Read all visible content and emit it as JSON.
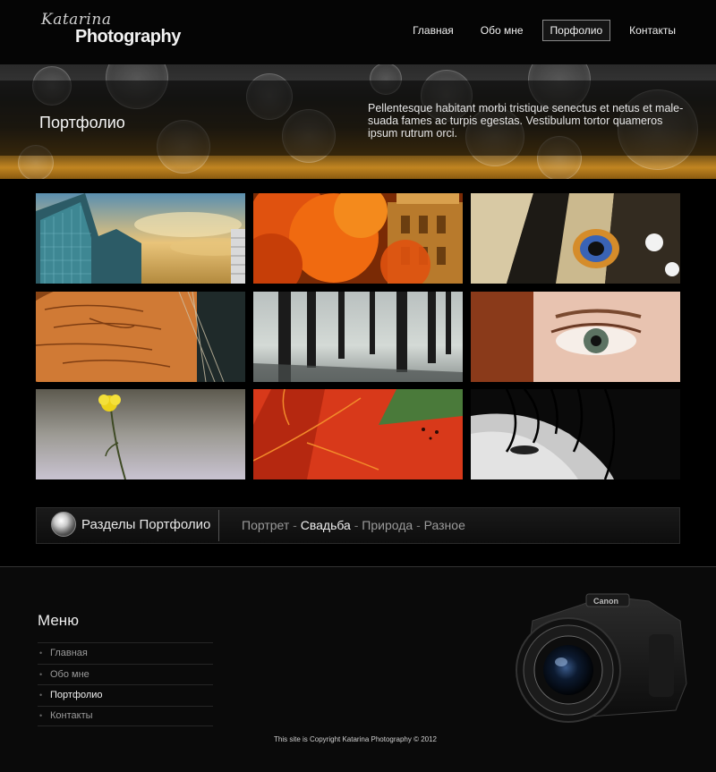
{
  "header": {
    "logo_script": "Katarina",
    "logo_main": "Photography",
    "nav": [
      {
        "label": "Главная",
        "active": false
      },
      {
        "label": "Обо мне",
        "active": false
      },
      {
        "label": "Порфолио",
        "active": true
      },
      {
        "label": "Контакты",
        "active": false
      }
    ]
  },
  "banner": {
    "title": "Портфолио",
    "text": "Pellentesque habitant morbi tristique senectus et netus et male-suada fames ac turpis egestas. Vestibulum tortor quameros ipsum rutrum orci."
  },
  "gallery": {
    "items": [
      {
        "subject": "building"
      },
      {
        "subject": "autumn-tree"
      },
      {
        "subject": "butterfly-wing"
      },
      {
        "subject": "old-face"
      },
      {
        "subject": "forest"
      },
      {
        "subject": "eye"
      },
      {
        "subject": "yellow-flower"
      },
      {
        "subject": "red-leaf"
      },
      {
        "subject": "bw-face"
      }
    ]
  },
  "sections": {
    "title": "Разделы Портфолио",
    "links": [
      "Портрет",
      "Свадьба",
      "Природа",
      "Разное"
    ],
    "separator": "-"
  },
  "footer": {
    "menu_title": "Меню",
    "menu": [
      "Главная",
      "Обо мне",
      "Портфолио",
      "Контакты"
    ],
    "copyright": "This site is Copyright Katarina Photography © 2012",
    "camera_brand": "Canon"
  }
}
